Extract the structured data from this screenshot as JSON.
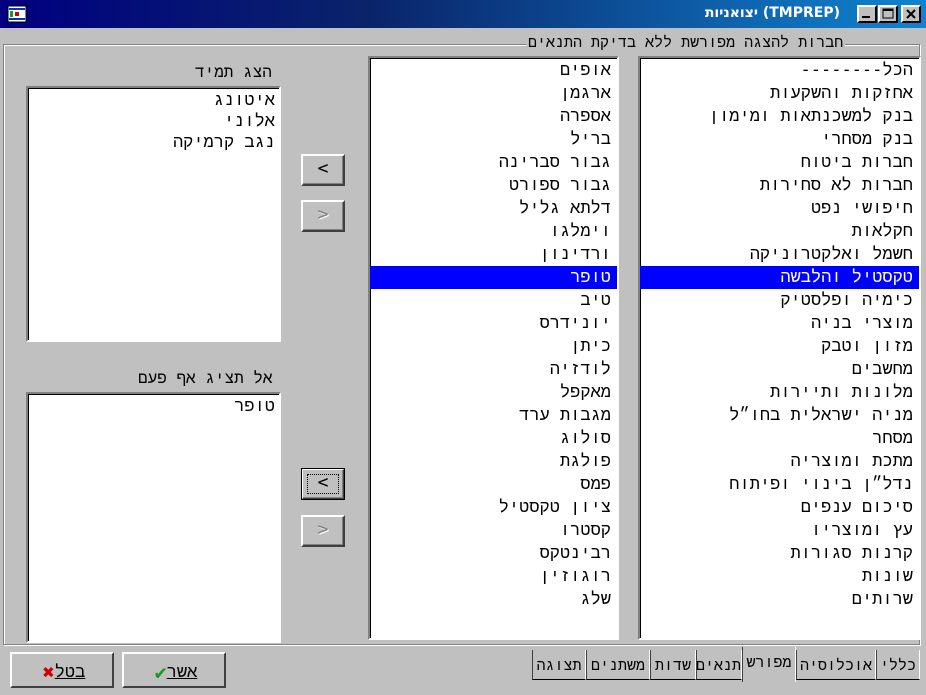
{
  "window": {
    "title": "יצואניות (TMPREP)",
    "app_icon": "flag-icon"
  },
  "group": {
    "title": "חברות להצגה מפורשת ללא בדיקת התנאים"
  },
  "categories": [
    "--------הכל",
    "אחזקות והשקעות",
    "בנק למשכנתאות ומימון",
    "בנק מסחרי",
    "חברות ביטוח",
    "חברות לא סחירות",
    "חיפושי נפט",
    "חקלאות",
    "חשמל ואלקטרוניקה",
    "טקסטיל והלבשה",
    "כימיה ופלסטיק",
    "מוצרי בניה",
    "מזון וטבק",
    "מחשבים",
    "מלונות ותיירות",
    "מניה ישראלית בחו״ל",
    "מסחר",
    "מתכת ומוצריה",
    "נדל״ן בינוי ופיתוח",
    "סיכום ענפים",
    "עץ ומוצריו",
    "קרנות סגורות",
    "שונות",
    "שרותים"
  ],
  "companies": [
    "אופים",
    "ארגמן",
    "אספרה",
    "בריל",
    "גבור סברינה",
    "גבור ספורט",
    "דלתא גליל",
    "וימלגו",
    "ורדינון",
    "טופר",
    "טיב",
    "יונידרס",
    "כיתן",
    "לודזיה",
    "מאקפל",
    "מגבות ערד",
    "סולוג",
    "פולגת",
    "פמס",
    "ציון טקסטיל",
    "קסטרו",
    "רבינטקס",
    "רוגוזין",
    "שלג"
  ],
  "selected_category": "טקסטיל והלבשה",
  "selected_company": "טופר",
  "always_show": {
    "label": "הצג תמיד",
    "items": [
      "איטונג",
      "אלוני",
      "נגב קרמיקה"
    ]
  },
  "never_show": {
    "label": "אל תציג אף פעם",
    "items": [
      "טופר"
    ]
  },
  "arrows": {
    "add": "<",
    "remove": ">"
  },
  "buttons": {
    "ok": "אשר",
    "cancel": "בטל"
  },
  "tabs": [
    "כללי",
    "אוכלוסיה",
    "מפורש",
    "תנאים",
    "שדות",
    "משתנים",
    "תצוגה"
  ],
  "active_tab": "מפורש",
  "colors": {
    "selection": "#0000ff",
    "titlebar": "#000080",
    "cancel_x": "#d00000",
    "ok_check": "#1a9a1a"
  }
}
